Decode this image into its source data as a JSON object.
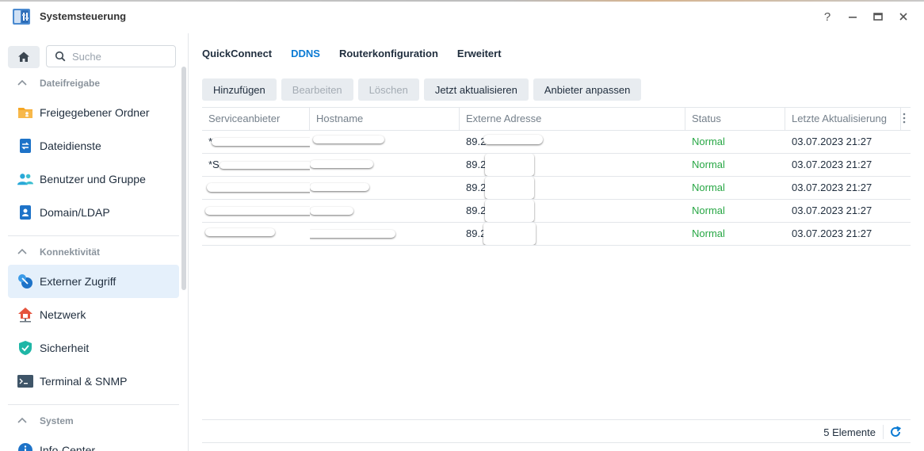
{
  "window": {
    "title": "Systemsteuerung",
    "help_label": "?",
    "minimize_label": "–",
    "maximize_label": "□",
    "close_label": "✕"
  },
  "sidebar": {
    "search_placeholder": "Suche",
    "sections": [
      {
        "label": "Dateifreigabe",
        "items": [
          {
            "label": "Freigegebener Ordner",
            "icon": "folder-share-icon"
          },
          {
            "label": "Dateidienste",
            "icon": "file-services-icon"
          },
          {
            "label": "Benutzer und Gruppe",
            "icon": "users-group-icon"
          },
          {
            "label": "Domain/LDAP",
            "icon": "domain-ldap-icon"
          }
        ]
      },
      {
        "label": "Konnektivität",
        "items": [
          {
            "label": "Externer Zugriff",
            "icon": "external-access-icon",
            "active": true
          },
          {
            "label": "Netzwerk",
            "icon": "network-icon"
          },
          {
            "label": "Sicherheit",
            "icon": "security-shield-icon"
          },
          {
            "label": "Terminal & SNMP",
            "icon": "terminal-icon"
          }
        ]
      },
      {
        "label": "System",
        "items": [
          {
            "label": "Info-Center",
            "icon": "info-icon"
          }
        ]
      }
    ]
  },
  "tabs": [
    {
      "label": "QuickConnect",
      "active": false
    },
    {
      "label": "DDNS",
      "active": true
    },
    {
      "label": "Routerkonfiguration",
      "active": false
    },
    {
      "label": "Erweitert",
      "active": false
    }
  ],
  "toolbar": {
    "add": "Hinzufügen",
    "edit": "Bearbeiten",
    "delete": "Löschen",
    "update_now": "Jetzt aktualisieren",
    "customize_provider": "Anbieter anpassen"
  },
  "table": {
    "columns": [
      "Serviceanbieter",
      "Hostname",
      "Externe Adresse",
      "Status",
      "Letzte Aktualisierung"
    ],
    "rows": [
      {
        "provider": "*",
        "hostname": "",
        "address": "89.2",
        "status": "Normal",
        "updated": "03.07.2023 21:27"
      },
      {
        "provider": "*S",
        "hostname": "",
        "address": "89.2",
        "status": "Normal",
        "updated": "03.07.2023 21:27"
      },
      {
        "provider": "",
        "hostname": "",
        "address": "89.2",
        "status": "Normal",
        "updated": "03.07.2023 21:27"
      },
      {
        "provider": "",
        "hostname": "",
        "address": "89.2",
        "status": "Normal",
        "updated": "03.07.2023 21:27"
      },
      {
        "provider": "",
        "hostname": "",
        "address": "89.2",
        "status": "Normal",
        "updated": "03.07.2023 21:27"
      }
    ]
  },
  "footer": {
    "count": "5 Elemente"
  },
  "colors": {
    "accent": "#0b7bd4",
    "status_ok": "#28a745",
    "active_bg": "#e5f0fb"
  }
}
